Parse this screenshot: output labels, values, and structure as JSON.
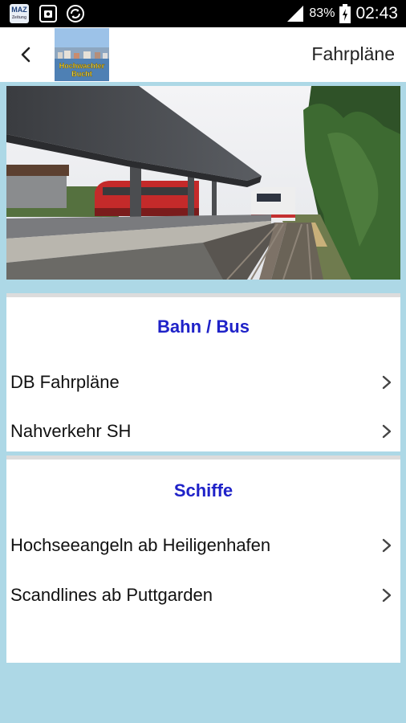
{
  "status_bar": {
    "app_badge": "MAZ",
    "app_badge_sub": "Zeitung",
    "battery": "83%",
    "time": "02:43"
  },
  "app_bar": {
    "title": "Fahrpläne",
    "logo_line1": "Hochwachter",
    "logo_line2": "Bucht"
  },
  "sections": [
    {
      "heading": "Bahn / Bus",
      "items": [
        {
          "label": "DB Fahrpläne"
        },
        {
          "label": "Nahverkehr SH"
        }
      ]
    },
    {
      "heading": "Schiffe",
      "items": [
        {
          "label": "Hochseeangeln ab Heiligenhafen"
        },
        {
          "label": "Scandlines ab Puttgarden"
        }
      ]
    }
  ],
  "colors": {
    "background": "#add8e6",
    "heading": "#1f22c8",
    "app_bar": "#ffffff",
    "status_bar": "#000000"
  }
}
